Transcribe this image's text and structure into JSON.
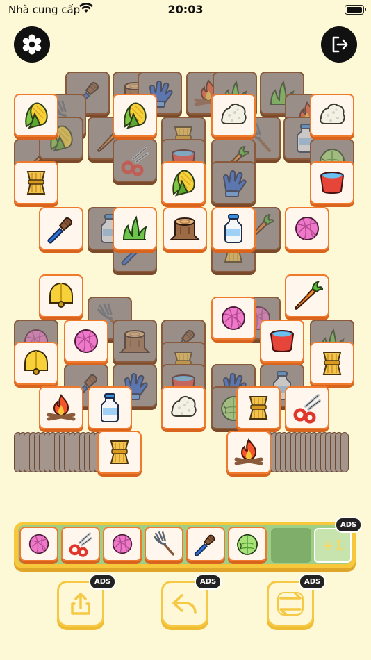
{
  "status_bar": {
    "carrier": "Nhà cung cấp",
    "time": "20:03"
  },
  "buttons": {
    "settings": "settings-icon",
    "exit": "exit-icon"
  },
  "board": {
    "top_group": {
      "back_layer": [
        "brush",
        "stump",
        "glove",
        "campfire",
        "grass",
        "grass",
        "corn",
        "rake",
        "carrot",
        "hay",
        "rice",
        "rake",
        "campfire",
        "corn",
        "carrot",
        "bucket",
        "glass",
        "lettuce",
        "corn",
        "shears",
        "glove",
        "bucket",
        "grass",
        "milk",
        "carrot",
        "brush",
        "hay"
      ],
      "front_tiles": [
        "corn",
        "corn",
        "rice",
        "rice",
        "hay",
        "corn",
        "bucket",
        "brush",
        "grass",
        "stump",
        "milk",
        "yarn"
      ]
    },
    "bottom_group": {
      "back_layer": [
        "rake",
        "yarn",
        "stump",
        "brush",
        "yarn",
        "grass",
        "brush",
        "glove",
        "hay",
        "bucket",
        "glove",
        "milk",
        "lettuce"
      ],
      "front_tiles": [
        "bell",
        "carrot",
        "yarn",
        "yarn",
        "bucket",
        "bell",
        "hay",
        "campfire",
        "milk",
        "rice",
        "hay",
        "shears",
        "hay",
        "campfire"
      ]
    }
  },
  "tray": {
    "tiles": [
      "yarn",
      "shears",
      "yarn",
      "rake",
      "brush",
      "lettuce"
    ],
    "empty_slots": 1,
    "plus_label": "+1"
  },
  "ads_label": "ADS",
  "tools": [
    "share",
    "undo",
    "shuffle"
  ],
  "colors": {
    "background": "#fdf8d6",
    "tile_edge": "#f07a2c",
    "tray": "#f8c83c",
    "tray_inner": "#9fcf86"
  }
}
